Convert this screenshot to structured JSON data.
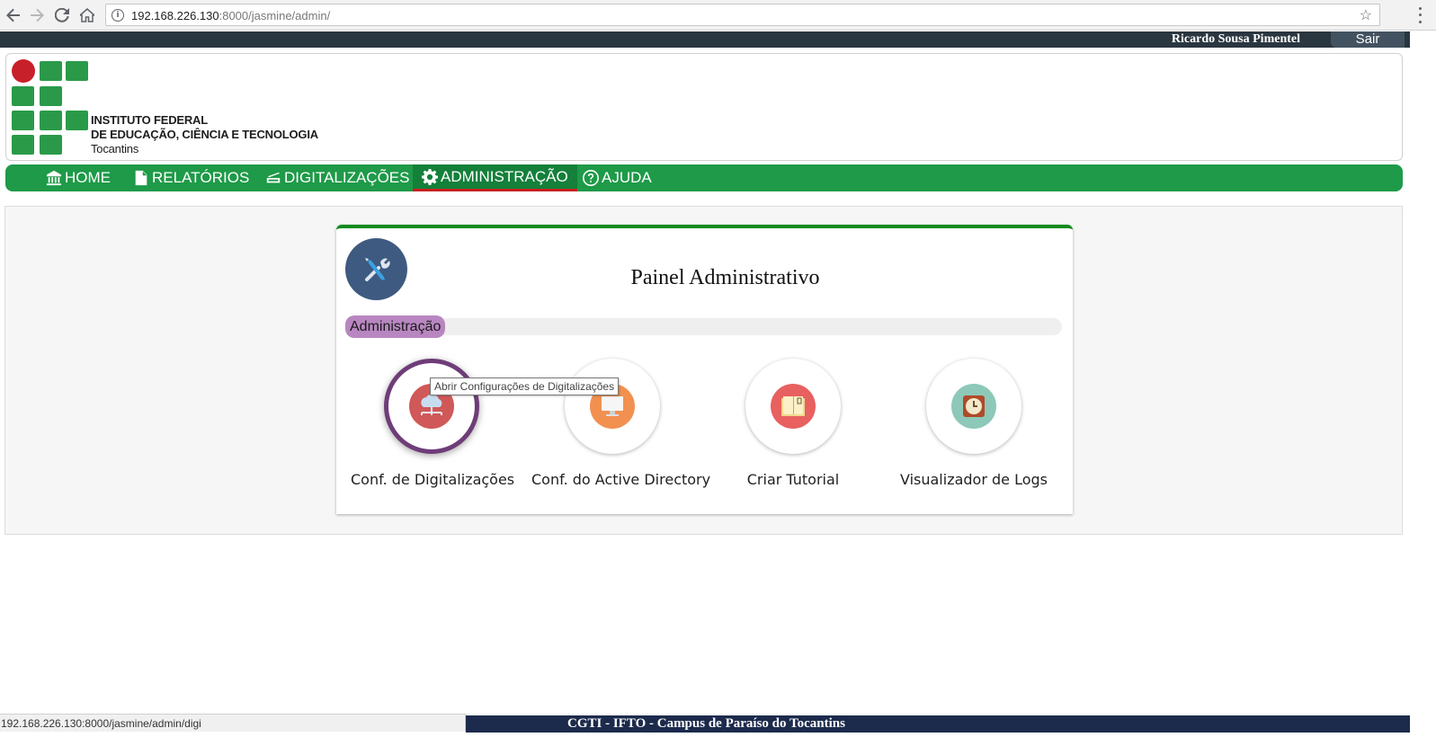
{
  "browser": {
    "url_host": "192.168.226.130",
    "url_path": ":8000/jasmine/admin/",
    "status_url": "192.168.226.130:8000/jasmine/admin/digi"
  },
  "user_bar": {
    "user_name": "Ricardo Sousa Pimentel",
    "logout_label": "Sair"
  },
  "logo": {
    "line1": "INSTITUTO FEDERAL",
    "line2": "DE EDUCAÇÃO, CIÊNCIA E TECNOLOGIA",
    "line3": "Tocantins"
  },
  "nav": {
    "items": [
      {
        "label": "HOME",
        "icon": "bank-icon"
      },
      {
        "label": "RELATÓRIOS",
        "icon": "document-icon"
      },
      {
        "label": "DIGITALIZAÇÕES",
        "icon": "scanner-icon"
      },
      {
        "label": "ADMINISTRAÇÃO",
        "icon": "gear-icon",
        "active": true
      },
      {
        "label": "AJUDA",
        "icon": "help-icon"
      }
    ]
  },
  "panel": {
    "title": "Painel Administrativo",
    "section_label": "Administração",
    "tiles": [
      {
        "label": "Conf. de Digitalizações",
        "icon": "cloud-network-icon",
        "color": "#e05a5a",
        "selected": true
      },
      {
        "label": "Conf. do Active Directory",
        "icon": "monitor-icon",
        "color": "#f29050"
      },
      {
        "label": "Criar Tutorial",
        "icon": "book-icon",
        "color": "#e86060"
      },
      {
        "label": "Visualizador de Logs",
        "icon": "clock-icon",
        "color": "#8dc8b8"
      }
    ],
    "tooltip": "Abrir Configurações de Digitalizações"
  },
  "footer": {
    "text": "CGTI - IFTO - Campus de Paraíso do Tocantins"
  },
  "colors": {
    "nav_green": "#1e9a48",
    "user_bar": "#2a3640",
    "footer": "#1c2a4c",
    "active_underline": "#c82020",
    "section_label": "#b886c0"
  }
}
